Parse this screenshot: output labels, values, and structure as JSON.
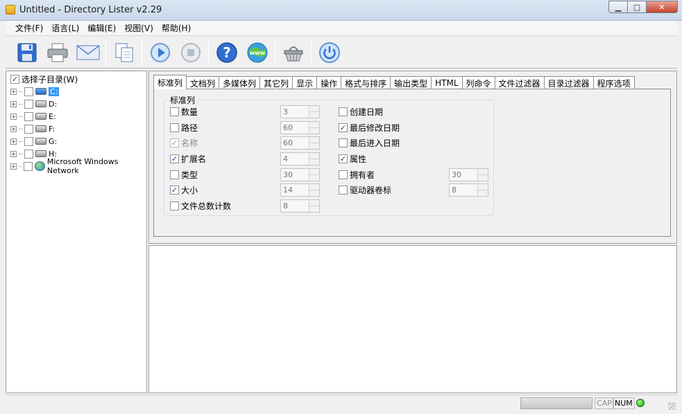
{
  "window": {
    "title": "Untitled - Directory Lister v2.29",
    "min": "▁",
    "max": "□",
    "close": "✕"
  },
  "menu": [
    "文件(F)",
    "语言(L)",
    "编辑(E)",
    "视图(V)",
    "帮助(H)"
  ],
  "toolbar": {
    "buttons": [
      "save-icon",
      "print-icon",
      "email-icon",
      "copy-icon",
      "play-icon",
      "stop-icon",
      "help-icon",
      "web-icon",
      "basket-icon",
      "power-icon"
    ],
    "colors": {
      "blue": "#2f6fcf",
      "grey": "#9aa3ad"
    }
  },
  "tree": {
    "header": "选择子目录(W)",
    "items": [
      {
        "label": "C:",
        "type": "system-drive",
        "selected": true
      },
      {
        "label": "D:",
        "type": "drive"
      },
      {
        "label": "E:",
        "type": "drive"
      },
      {
        "label": "F:",
        "type": "drive"
      },
      {
        "label": "G:",
        "type": "drive"
      },
      {
        "label": "H:",
        "type": "drive"
      },
      {
        "label": "Microsoft Windows Network",
        "type": "network"
      }
    ]
  },
  "tabs": [
    "标准列",
    "文档列",
    "多媒体列",
    "其它列",
    "显示",
    "操作",
    "格式与排序",
    "输出类型",
    "HTML",
    "列命令",
    "文件过滤器",
    "目录过滤器",
    "程序选项"
  ],
  "active_tab": "标准列",
  "group_title": "标准列",
  "left_options": [
    {
      "label": "数量",
      "checked": false,
      "disabled": false,
      "value": "3"
    },
    {
      "label": "路径",
      "checked": false,
      "disabled": false,
      "value": "60"
    },
    {
      "label": "名称",
      "checked": true,
      "disabled": true,
      "value": "60"
    },
    {
      "label": "扩展名",
      "checked": true,
      "disabled": false,
      "value": "4"
    },
    {
      "label": "类型",
      "checked": false,
      "disabled": false,
      "value": "30"
    },
    {
      "label": "大小",
      "checked": true,
      "disabled": false,
      "value": "14"
    },
    {
      "label": "文件总数计数",
      "checked": false,
      "disabled": false,
      "value": "8"
    }
  ],
  "right_options": [
    {
      "label": "创建日期",
      "checked": false
    },
    {
      "label": "最后修改日期",
      "checked": true
    },
    {
      "label": "最后进入日期",
      "checked": false
    },
    {
      "label": "属性",
      "checked": true
    },
    {
      "label": "拥有者",
      "checked": false,
      "value": "30"
    },
    {
      "label": "驱动器卷标",
      "checked": false,
      "value": "8"
    }
  ],
  "status": {
    "cap": "CAP",
    "num": "NUM",
    "led_color": "#1b9a12"
  }
}
